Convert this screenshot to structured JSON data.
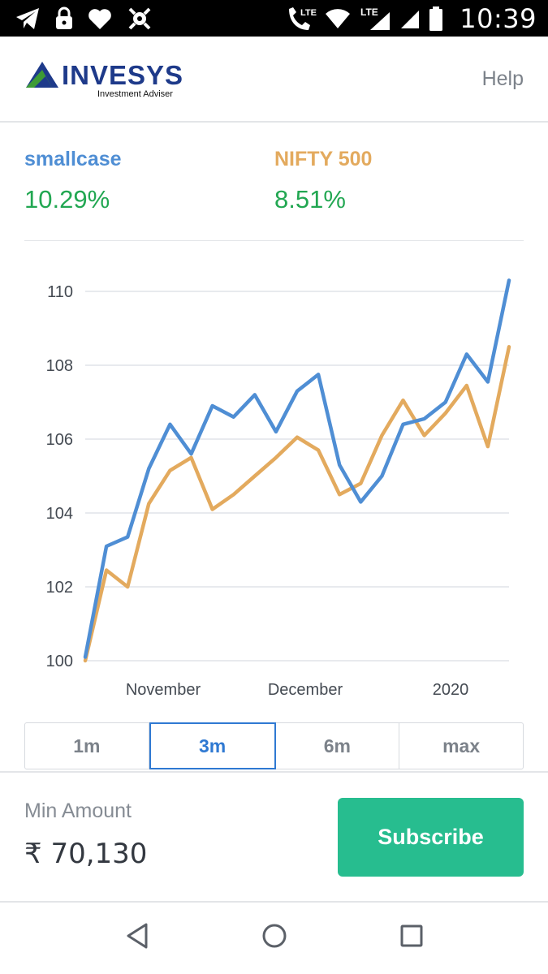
{
  "status_bar": {
    "time": "10:39",
    "network_label_1": "LTE",
    "network_label_2": "LTE",
    "icons": [
      "telegram-icon",
      "lock-icon",
      "heart-icon",
      "bug-icon",
      "wifi-call-icon",
      "wifi-icon",
      "signal-icon",
      "signal-icon",
      "battery-icon"
    ]
  },
  "header": {
    "logo_text": "INVESYS",
    "logo_subtitle": "Investment Adviser",
    "help_label": "Help"
  },
  "stats": [
    {
      "label": "smallcase",
      "value": "10.29%",
      "color": "#4f8ed4"
    },
    {
      "label": "NIFTY 500",
      "value": "8.51%",
      "color": "#e3aa5e"
    }
  ],
  "chart_data": {
    "type": "line",
    "x": [
      0,
      1,
      2,
      3,
      4,
      5,
      6,
      7,
      8,
      9,
      10,
      11,
      12,
      13,
      14,
      15,
      16,
      17,
      18,
      19,
      20,
      21,
      22
    ],
    "x_tick_labels": [
      "November",
      "December",
      "2020"
    ],
    "y_ticks": [
      100,
      102,
      104,
      106,
      108,
      110
    ],
    "ylim": [
      100,
      110.5
    ],
    "grid": true,
    "series": [
      {
        "name": "smallcase",
        "color": "#4f8ed4",
        "values": [
          100.1,
          103.1,
          103.35,
          105.2,
          106.4,
          105.6,
          106.9,
          106.6,
          107.2,
          106.2,
          107.3,
          107.75,
          105.3,
          104.3,
          105.0,
          106.4,
          106.55,
          107.0,
          108.3,
          107.55,
          110.3
        ]
      },
      {
        "name": "NIFTY 500",
        "color": "#e3aa5e",
        "values": [
          100.0,
          102.45,
          102.0,
          104.25,
          105.15,
          105.5,
          104.1,
          104.5,
          105.0,
          105.5,
          106.05,
          105.7,
          104.5,
          104.8,
          106.1,
          107.05,
          106.1,
          106.7,
          107.45,
          105.8,
          108.5
        ]
      }
    ]
  },
  "tabs": [
    {
      "label": "1m",
      "active": false
    },
    {
      "label": "3m",
      "active": true
    },
    {
      "label": "6m",
      "active": false
    },
    {
      "label": "max",
      "active": false
    }
  ],
  "footer": {
    "min_amount_label": "Min Amount",
    "min_amount_value": "₹ 70,130",
    "subscribe_label": "Subscribe"
  },
  "navbar": {
    "icons": [
      "back-icon",
      "home-icon",
      "recents-icon"
    ]
  }
}
